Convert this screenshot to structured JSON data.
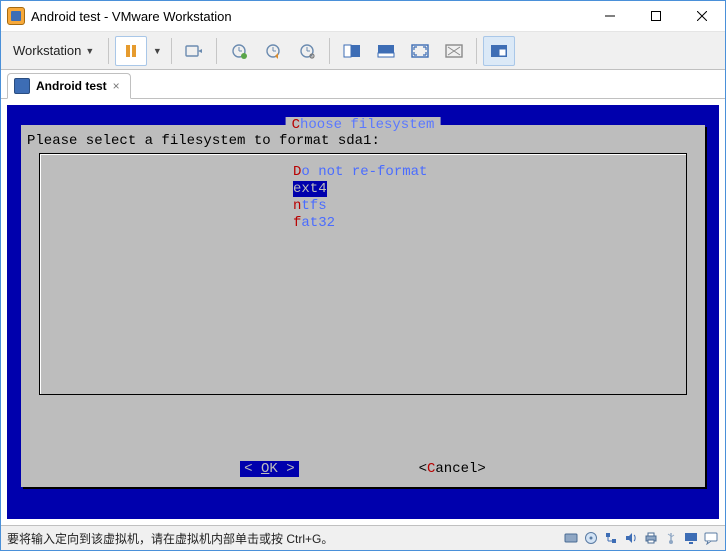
{
  "window": {
    "title": "Android test - VMware Workstation"
  },
  "menu": {
    "workstation_label": "Workstation"
  },
  "toolbar_icons": {
    "pause": "pause-icon",
    "drop": "dropdown-arrow-icon",
    "send": "send-ctrl-alt-del-icon",
    "snap_take": "snapshot-take-icon",
    "snap_revert": "snapshot-revert-icon",
    "snap_manage": "snapshot-manage-icon",
    "view_console": "console-view-icon",
    "view_unity": "unity-icon",
    "view_fullscreen": "fullscreen-icon",
    "view_unity2": "seamless-icon",
    "view_thumb": "thumbnail-icon"
  },
  "tab": {
    "label": "Android test"
  },
  "vm": {
    "dialog_title_first": "C",
    "dialog_title_rest": "hoose filesystem",
    "prompt": "Please select a filesystem to format sda1:",
    "options": [
      {
        "first": "D",
        "rest": "o not re-format",
        "selected": false
      },
      {
        "first": "e",
        "rest": "xt4",
        "selected": true
      },
      {
        "first": "n",
        "rest": "tfs",
        "selected": false
      },
      {
        "first": "f",
        "rest": "at32",
        "selected": false
      }
    ],
    "ok_left": "<",
    "ok_mid": "  ",
    "ok_label_u": "O",
    "ok_label_rest": "K",
    "ok_right": ">",
    "cancel_left": "<",
    "cancel_first": "C",
    "cancel_rest": "ancel",
    "cancel_right": ">"
  },
  "status": {
    "text": "要将输入定向到该虚拟机，请在虚拟机内部单击或按 Ctrl+G。"
  }
}
